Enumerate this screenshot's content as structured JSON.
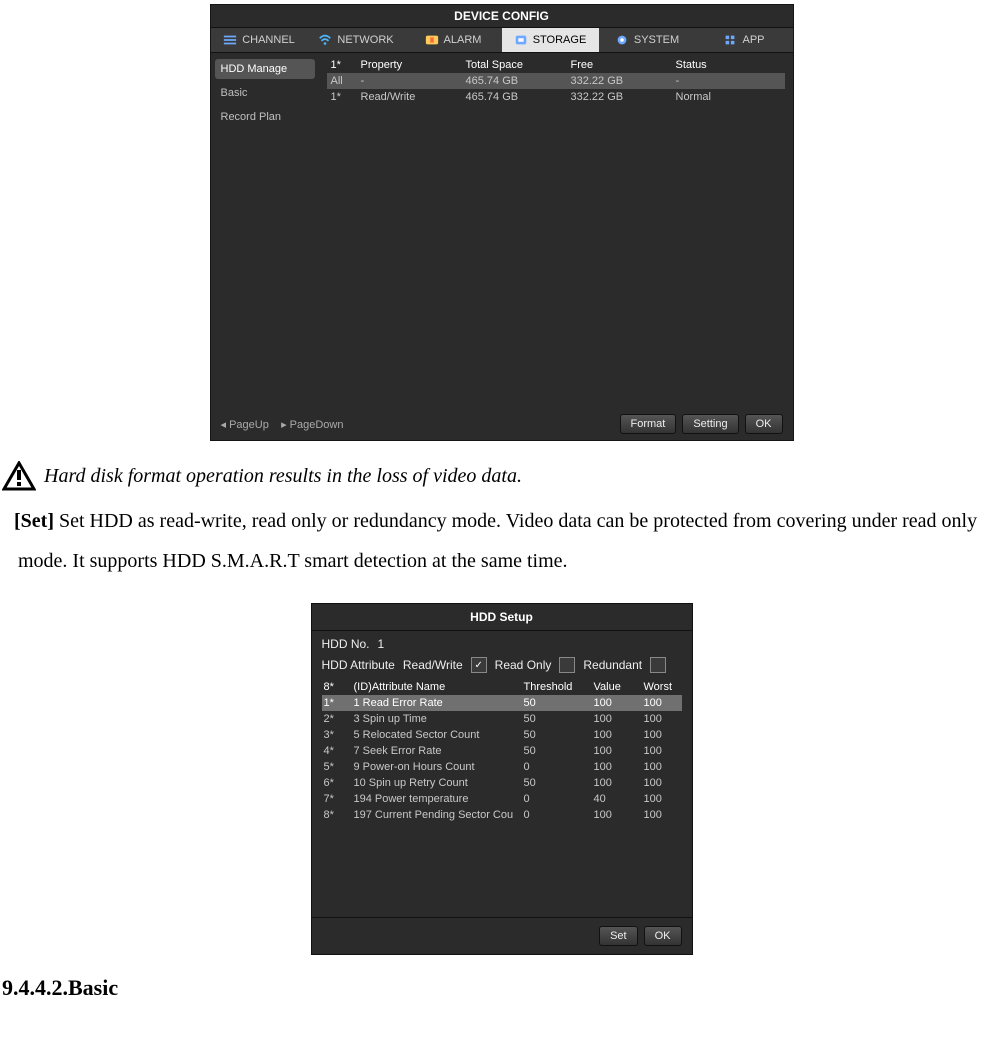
{
  "deviceConfig": {
    "title": "DEVICE CONFIG",
    "tabs": [
      "CHANNEL",
      "NETWORK",
      "ALARM",
      "STORAGE",
      "SYSTEM",
      "APP"
    ],
    "activeTab": 3,
    "sidebar": [
      {
        "label": "HDD Manage",
        "active": true
      },
      {
        "label": "Basic",
        "active": false
      },
      {
        "label": "Record Plan",
        "active": false
      }
    ],
    "hddTable": {
      "countHeader": "1*",
      "columns": [
        "Property",
        "Total Space",
        "Free",
        "Status"
      ],
      "rows": [
        {
          "id": "All",
          "prop": "-",
          "total": "465.74 GB",
          "free": "332.22 GB",
          "status": "-",
          "selected": true
        },
        {
          "id": "1*",
          "prop": "Read/Write",
          "total": "465.74 GB",
          "free": "332.22 GB",
          "status": "Normal",
          "selected": false
        }
      ]
    },
    "paging": {
      "pageUp": "PageUp",
      "pageDown": "PageDown"
    },
    "buttons": {
      "format": "Format",
      "setting": "Setting",
      "ok": "OK"
    }
  },
  "doc": {
    "warning": "Hard disk format operation results in the loss of video data.",
    "setTag": "[Set]",
    "setText": " Set HDD as read-write, read only or redundancy mode. Video data can be protected from covering under read only mode. It supports HDD S.M.A.R.T smart detection at the same time.",
    "heading": "9.4.4.2.Basic"
  },
  "hddSetup": {
    "title": "HDD Setup",
    "hddNoLabel": "HDD No.",
    "hddNoValue": "1",
    "attrLabel": "HDD Attribute",
    "options": {
      "readWrite": {
        "label": "Read/Write",
        "checked": true
      },
      "readOnly": {
        "label": "Read Only",
        "checked": false
      },
      "redundant": {
        "label": "Redundant",
        "checked": false
      }
    },
    "smartTable": {
      "countHeader": "8*",
      "columns": [
        "(ID)Attribute Name",
        "Threshold",
        "Value",
        "Worst"
      ],
      "rows": [
        {
          "idx": "1*",
          "name": "1 Read Error Rate",
          "th": "50",
          "val": "100",
          "worst": "100",
          "selected": true
        },
        {
          "idx": "2*",
          "name": "3 Spin up Time",
          "th": "50",
          "val": "100",
          "worst": "100"
        },
        {
          "idx": "3*",
          "name": "5 Relocated Sector Count",
          "th": "50",
          "val": "100",
          "worst": "100"
        },
        {
          "idx": "4*",
          "name": "7 Seek Error Rate",
          "th": "50",
          "val": "100",
          "worst": "100"
        },
        {
          "idx": "5*",
          "name": "9 Power-on Hours Count",
          "th": "0",
          "val": "100",
          "worst": "100"
        },
        {
          "idx": "6*",
          "name": "10 Spin up Retry Count",
          "th": "50",
          "val": "100",
          "worst": "100"
        },
        {
          "idx": "7*",
          "name": "194 Power temperature",
          "th": "0",
          "val": "40",
          "worst": "100"
        },
        {
          "idx": "8*",
          "name": "197 Current Pending Sector Cou",
          "th": "0",
          "val": "100",
          "worst": "100"
        }
      ]
    },
    "buttons": {
      "set": "Set",
      "ok": "OK"
    }
  }
}
